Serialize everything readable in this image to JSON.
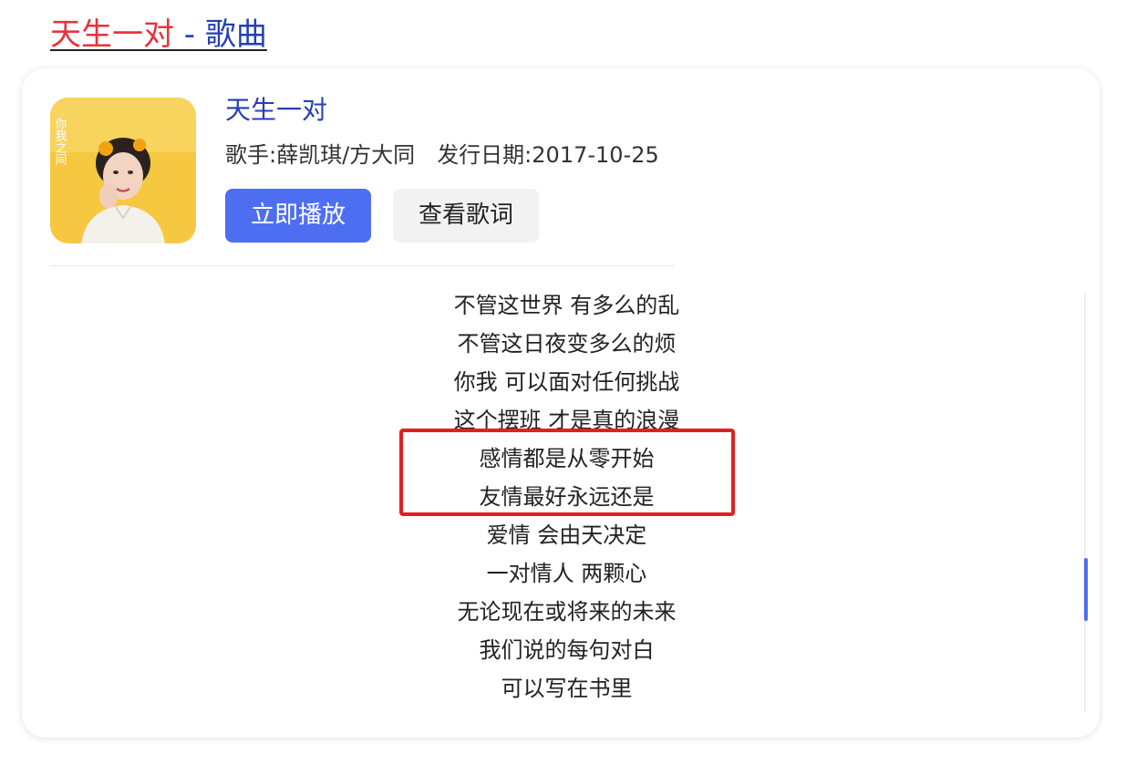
{
  "result": {
    "title_highlight": "天生一对",
    "title_rest": " - 歌曲"
  },
  "song": {
    "name": "天生一对",
    "singer_label": "歌手:",
    "singer": "薛凯琪/方大同",
    "date_label": "发行日期:",
    "date": "2017-10-25",
    "cover_icon": "album-cover-portrait",
    "cover_text": "你我之间"
  },
  "buttons": {
    "play": "立即播放",
    "lyrics": "查看歌词"
  },
  "lyrics": [
    "不管这世界 有多么的乱",
    "不管这日夜变多么的烦",
    "你我 可以面对任何挑战",
    "这个摆班 才是真的浪漫",
    "感情都是从零开始",
    "友情最好永远还是",
    "爱情 会由天决定",
    "一对情人 两颗心",
    "无论现在或将来的未来",
    "我们说的每句对白",
    "可以写在书里"
  ],
  "colors": {
    "highlight_red": "#e8323a",
    "link_blue": "#2440b3",
    "primary_button": "#4e6ef2",
    "annotation_red": "#e02020"
  }
}
